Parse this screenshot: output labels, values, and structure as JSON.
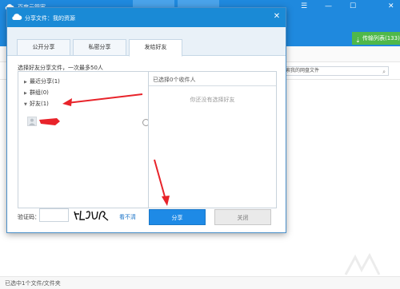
{
  "app": {
    "title": "百度云管家",
    "transfer_label": "传输列表(133)",
    "transfer_icon": "download-arrow-icon",
    "search_placeholder": "搜索我的网盘文件",
    "status_text": "已选中1个文件/文件夹",
    "window_controls": [
      "☰",
      "—",
      "☐",
      "✕"
    ]
  },
  "dialog": {
    "title": "分享文件：我的资源",
    "close_icon": "✕",
    "tabs": [
      {
        "label": "公开分享",
        "active": false
      },
      {
        "label": "私密分享",
        "active": false
      },
      {
        "label": "发给好友",
        "active": true
      }
    ],
    "instruction": "选择好友分享文件，一次最多50人",
    "tree": [
      {
        "label": "最近分享(1)",
        "expanded": false
      },
      {
        "label": "群组(0)",
        "expanded": false
      },
      {
        "label": "好友(1)",
        "expanded": true
      }
    ],
    "selected_count": "已选择0个收件人",
    "empty_hint": "你还没有选择好友",
    "captcha_label": "验证码：",
    "captcha_refresh": "看不清",
    "share_button": "分享",
    "close_button": "关闭"
  },
  "colors": {
    "accent": "#1a8ad6",
    "primary_button": "#1e8ae6",
    "transfer_green": "#4fb84a",
    "annotation_red": "#e8232a"
  }
}
